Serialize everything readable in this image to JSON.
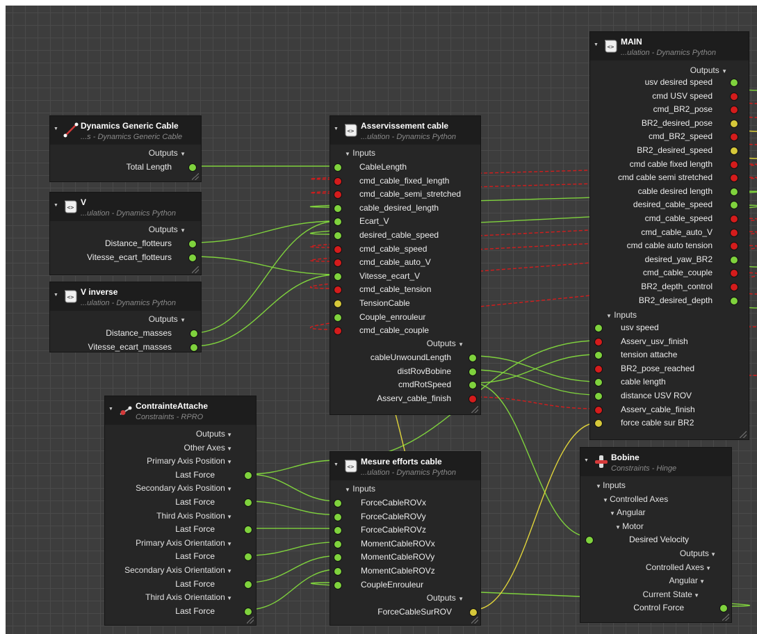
{
  "nodes": {
    "dgc": {
      "title": "Dynamics Generic Cable",
      "subtitle": "...s - Dynamics Generic Cable",
      "outputs_label": "Outputs",
      "outputs": [
        "Total Length"
      ]
    },
    "v": {
      "title": "V",
      "subtitle": "...ulation - Dynamics Python",
      "outputs_label": "Outputs",
      "outputs": [
        "Distance_flotteurs",
        "Vitesse_ecart_flotteurs"
      ]
    },
    "vinv": {
      "title": "V inverse",
      "subtitle": "...ulation - Dynamics Python",
      "outputs_label": "Outputs",
      "outputs": [
        "Distance_masses",
        "Vitesse_ecart_masses"
      ]
    },
    "asserv": {
      "title": "Asservissement cable",
      "subtitle": "...ulation - Dynamics Python",
      "inputs_label": "Inputs",
      "inputs": [
        "CableLength",
        "cmd_cable_fixed_length",
        "cmd_cable_semi_stretched",
        "cable_desired_length",
        "Ecart_V",
        "desired_cable_speed",
        "cmd_cable_speed",
        "cmd_cable_auto_V",
        "Vitesse_ecart_V",
        "cmd_cable_tension",
        "TensionCable",
        "Couple_enrouleur",
        "cmd_cable_couple"
      ],
      "outputs_label": "Outputs",
      "outputs": [
        "cableUnwoundLength",
        "distRovBobine",
        "cmdRotSpeed",
        "Asserv_cable_finish"
      ]
    },
    "main": {
      "title": "MAIN",
      "subtitle": "...ulation - Dynamics Python",
      "outputs_label": "Outputs",
      "outputs": [
        "usv desired speed",
        "cmd USV speed",
        "cmd_BR2_pose",
        "BR2_desired_pose",
        "cmd_BR2_speed",
        "BR2_desired_speed",
        "cmd cable fixed length",
        "cmd cable semi stretched",
        "cable desired length",
        "desired_cable_speed",
        "cmd_cable_speed",
        "cmd_cable_auto_V",
        "cmd cable auto tension",
        "desired_yaw_BR2",
        "cmd_cable_couple",
        "BR2_depth_control",
        "BR2_desired_depth"
      ],
      "inputs_label": "Inputs",
      "inputs": [
        "usv speed",
        "Asserv_usv_finish",
        "tension attache",
        "BR2_pose_reached",
        "cable length",
        "distance USV ROV",
        "Asserv_cable_finish",
        "force cable sur BR2"
      ]
    },
    "contrainte": {
      "title": "ContrainteAttache",
      "subtitle": "Constraints - RPRO",
      "rows": [
        "Outputs",
        "Other Axes",
        "Primary Axis Position",
        "Last Force",
        "Secondary Axis Position",
        "Last Force",
        "Third Axis Position",
        "Last Force",
        "Primary Axis Orientation",
        "Last Force",
        "Secondary Axis Orientation",
        "Last Force",
        "Third Axis Orientation",
        "Last Force"
      ]
    },
    "mesure": {
      "title": "Mesure efforts cable",
      "subtitle": "...ulation - Dynamics Python",
      "inputs_label": "Inputs",
      "inputs": [
        "ForceCableROVx",
        "ForceCableROVy",
        "ForceCableROVz",
        "MomentCableROVx",
        "MomentCableROVy",
        "MomentCableROVz",
        "CoupleEnrouleur"
      ],
      "outputs_label": "Outputs",
      "outputs": [
        "ForceCableSurROV"
      ]
    },
    "bobine": {
      "title": "Bobine",
      "subtitle": "Constraints - Hinge",
      "rows": [
        "Inputs",
        "Controlled Axes",
        "Angular",
        "Motor",
        "Desired Velocity",
        "Outputs",
        "Controlled Axes",
        "Angular",
        "Current State",
        "Control Force"
      ]
    }
  },
  "colors": {
    "green": "#7fd23d",
    "red": "#d41c1c",
    "yellow": "#d6c83a",
    "wire_green": "#7fd23d",
    "wire_red": "#d41c1c",
    "wire_yellow": "#e0d43a"
  }
}
